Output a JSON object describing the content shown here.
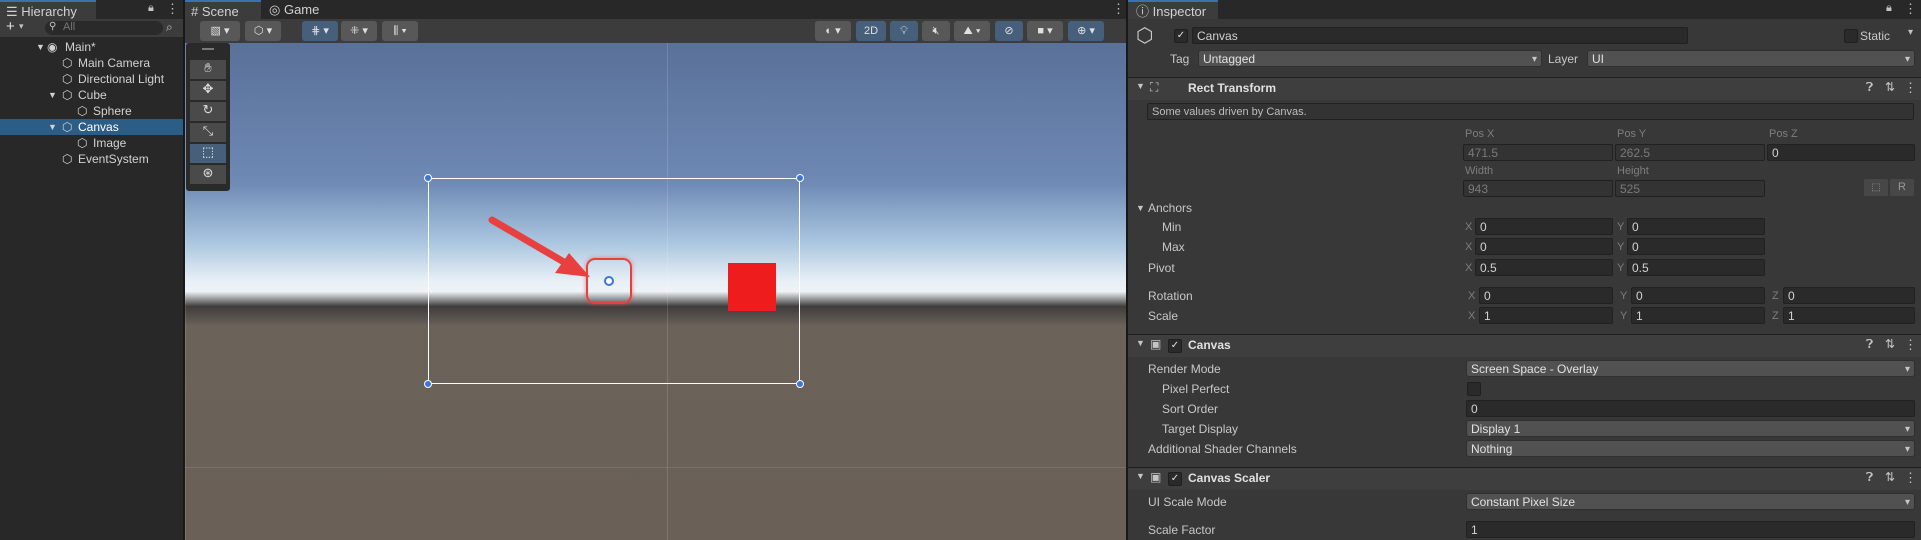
{
  "hierarchy": {
    "tab": "Hierarchy",
    "search_placeholder": "All",
    "add_label": "+",
    "items": [
      {
        "label": "Main*"
      },
      {
        "label": "Main Camera"
      },
      {
        "label": "Directional Light"
      },
      {
        "label": "Cube"
      },
      {
        "label": "Sphere"
      },
      {
        "label": "Canvas"
      },
      {
        "label": "Image"
      },
      {
        "label": "EventSystem"
      }
    ]
  },
  "scene": {
    "tabs": {
      "scene": "Scene",
      "game": "Game"
    },
    "toolbar": {
      "mode_2d": "2D"
    }
  },
  "inspector": {
    "tab": "Inspector",
    "object_name": "Canvas",
    "static_label": "Static",
    "tag_label": "Tag",
    "tag_value": "Untagged",
    "layer_label": "Layer",
    "layer_value": "UI",
    "rect_transform": {
      "title": "Rect Transform",
      "note": "Some values driven by Canvas.",
      "pos_x_label": "Pos X",
      "pos_y_label": "Pos Y",
      "pos_z_label": "Pos Z",
      "pos_x": "471.5",
      "pos_y": "262.5",
      "pos_z": "0",
      "width_label": "Width",
      "height_label": "Height",
      "width": "943",
      "height": "525",
      "r_button": "R",
      "anchors_label": "Anchors",
      "min_label": "Min",
      "max_label": "Max",
      "min_x": "0",
      "min_y": "0",
      "max_x": "0",
      "max_y": "0",
      "pivot_label": "Pivot",
      "pivot_x": "0.5",
      "pivot_y": "0.5",
      "rotation_label": "Rotation",
      "rot_x": "0",
      "rot_y": "0",
      "rot_z": "0",
      "scale_label": "Scale",
      "scale_x": "1",
      "scale_y": "1",
      "scale_z": "1",
      "x": "X",
      "y": "Y",
      "z": "Z"
    },
    "canvas": {
      "title": "Canvas",
      "render_mode_label": "Render Mode",
      "render_mode": "Screen Space - Overlay",
      "pixel_perfect_label": "Pixel Perfect",
      "sort_order_label": "Sort Order",
      "sort_order": "0",
      "target_display_label": "Target Display",
      "target_display": "Display 1",
      "shader_channels_label": "Additional Shader Channels",
      "shader_channels": "Nothing"
    },
    "canvas_scaler": {
      "title": "Canvas Scaler",
      "ui_scale_mode_label": "UI Scale Mode",
      "ui_scale_mode": "Constant Pixel Size",
      "scale_factor_label": "Scale Factor",
      "scale_factor": "1"
    }
  },
  "colors": {
    "accent": "#3a72b0",
    "selection": "#2c5d87",
    "annotation": "#e8403f",
    "square": "#ee1c1c"
  }
}
